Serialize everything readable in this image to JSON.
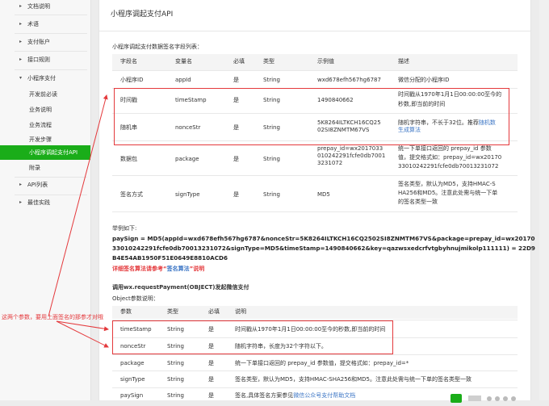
{
  "sidebar": {
    "items": [
      {
        "label": "文档说明",
        "arrow": "▸"
      },
      {
        "label": "术语",
        "arrow": "▸"
      },
      {
        "label": "支付账户",
        "arrow": "▸"
      },
      {
        "label": "接口规则",
        "arrow": "▸"
      },
      {
        "label": "小程序支付",
        "arrow": "▾"
      },
      {
        "label": "开发前必读"
      },
      {
        "label": "业务说明"
      },
      {
        "label": "业务流程"
      },
      {
        "label": "开发步骤"
      },
      {
        "label": "小程序调起支付API"
      },
      {
        "label": "附录"
      },
      {
        "label": "API列表",
        "arrow": "▸"
      },
      {
        "label": "最佳实践",
        "arrow": "▸"
      }
    ]
  },
  "main": {
    "title": "小程序调起支付API",
    "sign_caption": "小程序调起支付数据签名字段列表：",
    "sign_table": {
      "headers": [
        "字段名",
        "变量名",
        "必填",
        "类型",
        "示例值",
        "描述"
      ],
      "rows": [
        {
          "name": "小程序ID",
          "var": "appId",
          "req": "是",
          "type": "String",
          "example": "wxd678efh567hg6787",
          "desc": [
            "微信分配的小程序ID"
          ]
        },
        {
          "name": "时间戳",
          "var": "timeStamp",
          "req": "是",
          "type": "String",
          "example": "1490840662",
          "desc": [
            "时间戳从1970年1月1日00:00:00至今的",
            "秒数,即当前的时间"
          ]
        },
        {
          "name": "随机串",
          "var": "nonceStr",
          "req": "是",
          "type": "String",
          "example": "5K8264ILTKCH16CQ25\n02SI8ZNMTM67VS",
          "desc1": "随机字符串，不长于32位。推荐",
          "desc_link1": "随机数",
          "desc_link2": "生成算法"
        },
        {
          "name": "数据包",
          "var": "package",
          "req": "是",
          "type": "String",
          "example": "prepay_id=wx2017033\n010242291fcfe0db7001\n3231072",
          "desc": [
            "统一下单接口返回的 prepay_id 参数",
            "值，提交格式如：prepay_id=wx20170",
            "33010242291fcfe0db70013231072"
          ]
        },
        {
          "name": "签名方式",
          "var": "signType",
          "req": "是",
          "type": "String",
          "example": "MD5",
          "desc": [
            "签名类型，默认为MD5，支持HMAC-S",
            "HA256和MD5。注意此处需与统一下单",
            "的签名类型一致"
          ]
        }
      ]
    },
    "example_caption": "举例如下:",
    "code_lines": [
      "paySign = MD5(appId=wxd678efh567hg6787&nonceStr=5K8264ILTKCH16CQ2502SI8ZNMTM67VS&package=prepay_id=wx20170",
      "33010242291fcfe0db70013231072&signType=MD5&timeStamp=1490840662&key=qazwsxedcrfvtgbyhnujmikolp111111) = 22D9",
      "B4E54AB1950F51E0649E8810ACD6"
    ],
    "detail_note": "详细签名算法请参考“",
    "detail_link": "签名算法",
    "detail_note_end": "”说明",
    "request_title": "调用wx.requestPayment(OBJECT)发起微信支付",
    "object_caption": "Object参数说明：",
    "param_table": {
      "headers": [
        "参数",
        "类型",
        "必填",
        "说明"
      ],
      "rows": [
        {
          "name": "timeStamp",
          "type": "String",
          "req": "是",
          "desc": "时间戳从1970年1月1日00:00:00至今的秒数,即当前的时间"
        },
        {
          "name": "nonceStr",
          "type": "String",
          "req": "是",
          "desc": "随机字符串，长度为32个字符以下。"
        },
        {
          "name": "package",
          "type": "String",
          "req": "是",
          "desc": "统一下单接口返回的 prepay_id 参数值，提交格式如：prepay_id=*"
        },
        {
          "name": "signType",
          "type": "String",
          "req": "是",
          "desc": "签名类型，默认为MD5，支持HMAC-SHA256和MD5。注意此处需与统一下单的签名类型一致"
        },
        {
          "name": "paySign",
          "type": "String",
          "req": "是",
          "desc": "签名,具体签名方案参见",
          "desc_link": "微信公众号支付帮助文档"
        }
      ]
    },
    "annotation": "这两个参数，要用上面签名的那参才对哦"
  },
  "colors": {
    "accent": "#1aad19",
    "highlight": "#e4393c",
    "link": "#3c76c5"
  }
}
